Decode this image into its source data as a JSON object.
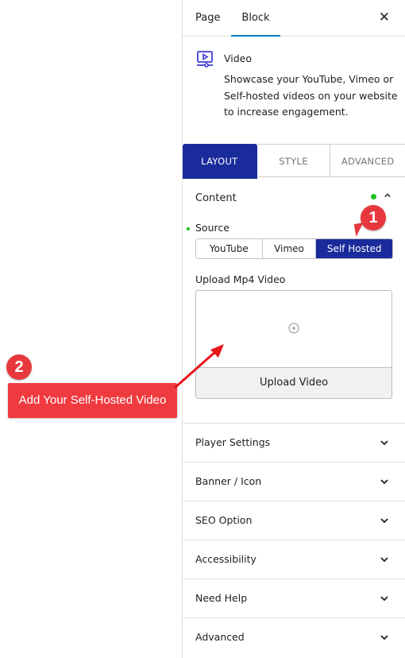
{
  "sidebar": {
    "tabs": [
      {
        "label": "Page",
        "active": false
      },
      {
        "label": "Block",
        "active": true
      }
    ],
    "close_icon": "close-icon",
    "block": {
      "icon": "video-icon",
      "title": "Video",
      "description": "Showcase your YouTube, Vimeo or Self-hosted videos on your website to increase engagement."
    },
    "panel_tabs": [
      {
        "label": "LAYOUT",
        "active": true
      },
      {
        "label": "STYLE",
        "active": false
      },
      {
        "label": "ADVANCED",
        "active": false
      }
    ],
    "content_section": {
      "title": "Content",
      "expanded": true,
      "source": {
        "label": "Source",
        "options": [
          "YouTube",
          "Vimeo",
          "Self Hosted"
        ],
        "selected": "Self Hosted"
      },
      "upload": {
        "label": "Upload Mp4 Video",
        "button_label": "Upload Video"
      }
    },
    "sections": [
      {
        "label": "Player Settings"
      },
      {
        "label": "Banner / Icon"
      },
      {
        "label": "SEO Option"
      },
      {
        "label": "Accessibility"
      },
      {
        "label": "Need Help"
      },
      {
        "label": "Advanced"
      }
    ]
  },
  "annotations": {
    "step1": "1",
    "step2": "2",
    "callout_text": "Add Your Self-Hosted Video",
    "accent_color": "#ef3b3f"
  },
  "colors": {
    "primary": "#1a2b9b",
    "tab_underline": "#007cba",
    "status_green": "#1bc21b"
  }
}
